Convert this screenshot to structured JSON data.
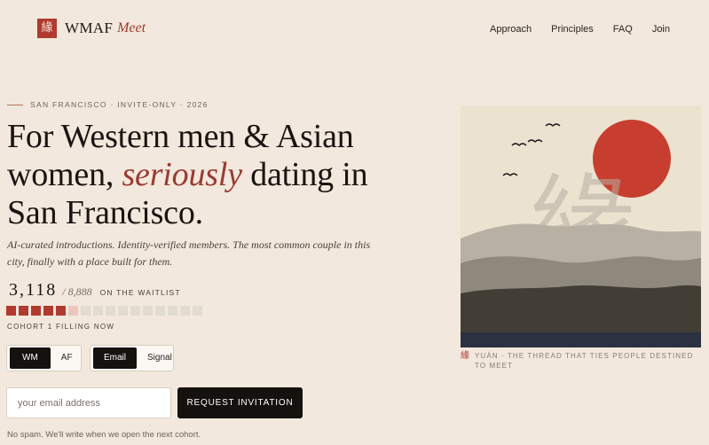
{
  "header": {
    "logo_glyph": "緣",
    "brand": "WMAF",
    "brand_sub": "Meet",
    "nav": [
      "Approach",
      "Principles",
      "FAQ",
      "Join"
    ]
  },
  "hero": {
    "eyebrow": "SAN FRANCISCO · INVITE-ONLY · 2026",
    "headline_part1": "For Western men & Asian women, ",
    "headline_emphasis": "seriously",
    "headline_part2": " dating in San Francisco.",
    "subhead": "AI-curated introductions. Identity-verified members. The most common couple in this city, finally with a place built for them."
  },
  "waitlist": {
    "count": "3,118",
    "total": "/ 8,888",
    "label": "ON THE WAITLIST",
    "progress_fraction": 0.351,
    "cells_total": 16,
    "cells_filled": 5,
    "cells_partial": 1,
    "cohort_status": "COHORT 1 FILLING NOW"
  },
  "toggles": {
    "identity": {
      "options": [
        "WM",
        "AF"
      ],
      "selected": "WM"
    },
    "contact": {
      "options": [
        "Email",
        "Signal"
      ],
      "selected": "Email"
    }
  },
  "signup": {
    "email_placeholder": "your email address",
    "email_value": "",
    "button_label": "REQUEST INVITATION",
    "footnote": "No spam. We'll write when we open the next cohort."
  },
  "art": {
    "watermark_glyph": "緣",
    "caption_glyph": "緣",
    "caption": "YUÁN · THE THREAD THAT TIES PEOPLE DESTINED TO MEET"
  },
  "colors": {
    "background": "#f2e8dd",
    "accent": "#b13a2e",
    "ink": "#15110e",
    "sun": "#c73e30"
  }
}
